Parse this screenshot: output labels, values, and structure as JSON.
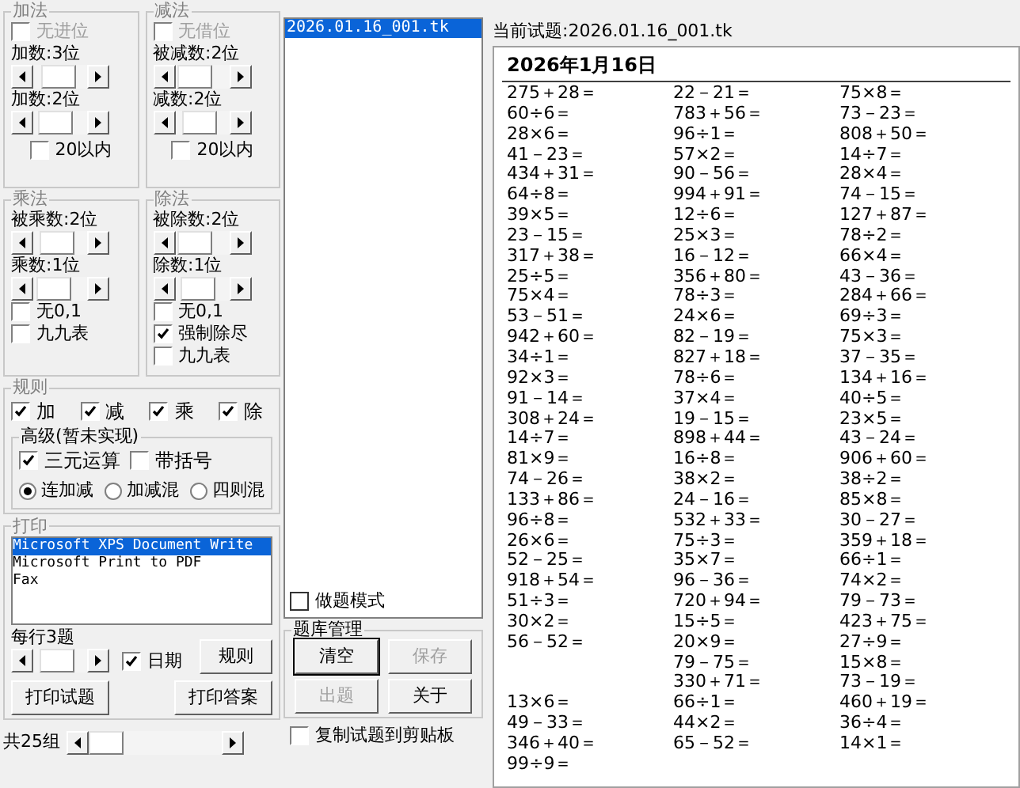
{
  "ops_groups": [
    {
      "title": "加法",
      "items": [
        {
          "kind": "checkbox",
          "label": "无进位",
          "checked": false,
          "disabled": true
        },
        {
          "kind": "slider",
          "label": "加数:3位",
          "level": 0.45
        },
        {
          "kind": "slider",
          "label": "加数:2位",
          "level": 0.25
        },
        {
          "kind": "footer_checkbox",
          "label": "20以内",
          "checked": false,
          "disabled": false
        }
      ]
    },
    {
      "title": "减法",
      "items": [
        {
          "kind": "checkbox",
          "label": "无借位",
          "checked": false,
          "disabled": true
        },
        {
          "kind": "slider",
          "label": "被减数:2位",
          "level": 0.15
        },
        {
          "kind": "slider",
          "label": "减数:2位",
          "level": 0.35
        },
        {
          "kind": "footer_checkbox",
          "label": "20以内",
          "checked": false,
          "disabled": false
        }
      ]
    },
    {
      "title": "乘法",
      "items": [
        {
          "kind": "slider",
          "label": "被乘数:2位",
          "level": 0.35
        },
        {
          "kind": "slider",
          "label": "乘数:1位",
          "level": 0.15
        },
        {
          "kind": "checkbox",
          "label": "无0,1",
          "checked": false,
          "disabled": false
        },
        {
          "kind": "checkbox",
          "label": "九九表",
          "checked": false,
          "disabled": false
        }
      ]
    },
    {
      "title": "除法",
      "items": [
        {
          "kind": "slider",
          "label": "被除数:2位",
          "level": 0.15
        },
        {
          "kind": "slider",
          "label": "除数:1位",
          "level": 0.3
        },
        {
          "kind": "checkbox",
          "label": "无0,1",
          "checked": false,
          "disabled": false
        },
        {
          "kind": "checkbox",
          "label": "强制除尽",
          "checked": true,
          "disabled": false
        },
        {
          "kind": "checkbox",
          "label": "九九表",
          "checked": false,
          "disabled": false
        }
      ]
    }
  ],
  "rules": {
    "title": "规则",
    "ops": [
      {
        "label": "加",
        "checked": true
      },
      {
        "label": "减",
        "checked": true
      },
      {
        "label": "乘",
        "checked": true
      },
      {
        "label": "除",
        "checked": true
      }
    ],
    "advanced": {
      "title": "高级(暂未实现)",
      "options": [
        {
          "label": "三元运算",
          "checked": true
        },
        {
          "label": "带括号",
          "checked": false
        }
      ],
      "modes": [
        {
          "label": "连加减",
          "selected": true
        },
        {
          "label": "加减混",
          "selected": false
        },
        {
          "label": "四则混",
          "selected": false
        }
      ]
    }
  },
  "print": {
    "title": "打印",
    "printers": [
      {
        "name": "Microsoft XPS Document Write",
        "selected": true
      },
      {
        "name": "Microsoft Print to PDF",
        "selected": false
      },
      {
        "name": "Fax",
        "selected": false
      }
    ],
    "per_row": {
      "label": "每行3题",
      "level": 0.3
    },
    "date": {
      "label": "日期",
      "checked": true
    },
    "rules_button": "规则",
    "print_questions": "打印试题",
    "print_answers": "打印答案"
  },
  "groups_count": {
    "label": "共25组",
    "level": 0
  },
  "files": [
    {
      "name": "2026.01.16_001.tk",
      "selected": true
    }
  ],
  "practice_mode": {
    "label": "做题模式",
    "checked": false
  },
  "bank": {
    "title": "题库管理",
    "buttons": [
      {
        "label": "清空",
        "disabled": false,
        "focused": true
      },
      {
        "label": "保存",
        "disabled": true,
        "focused": false
      },
      {
        "label": "出题",
        "disabled": true,
        "focused": false
      },
      {
        "label": "关于",
        "disabled": false,
        "focused": false
      }
    ]
  },
  "copy_to_clipboard": {
    "label": "复制试题到剪贴板",
    "checked": false
  },
  "current": "当前试题:2026.01.16_001.tk",
  "sheet": {
    "title": "2026年1月16日",
    "columns": [
      [
        "275＋28＝",
        "60÷6＝",
        "28×6＝",
        "41－23＝",
        "434＋31＝",
        "64÷8＝",
        "39×5＝",
        "23－15＝",
        "317＋38＝",
        "25÷5＝",
        "75×4＝",
        "53－51＝",
        "942＋60＝",
        "34÷1＝",
        "92×3＝",
        "91－14＝",
        "308＋24＝",
        "14÷7＝",
        "81×9＝",
        "74－26＝",
        "133＋86＝",
        "96÷8＝",
        "26×6＝",
        "52－25＝",
        "918＋54＝",
        "51÷3＝",
        "30×2＝",
        "56－52＝",
        null,
        null,
        "13×6＝",
        "49－33＝",
        "346＋40＝",
        "99÷9＝"
      ],
      [
        "22－21＝",
        "783＋56＝",
        "96÷1＝",
        "57×2＝",
        "90－56＝",
        "994＋91＝",
        "12÷6＝",
        "25×3＝",
        "16－12＝",
        "356＋80＝",
        "78÷3＝",
        "24×6＝",
        "82－19＝",
        "827＋18＝",
        "78÷6＝",
        "37×4＝",
        "19－15＝",
        "898＋44＝",
        "16÷8＝",
        "38×2＝",
        "24－16＝",
        "532＋33＝",
        "75÷3＝",
        "35×7＝",
        "96－36＝",
        "720＋94＝",
        "15÷5＝",
        "20×9＝",
        "79－75＝",
        "330＋71＝",
        "66÷1＝",
        "44×2＝",
        "65－52＝"
      ],
      [
        "75×8＝",
        "73－23＝",
        "808＋50＝",
        "14÷7＝",
        "28×4＝",
        "74－15＝",
        "127＋87＝",
        "78÷2＝",
        "66×4＝",
        "43－36＝",
        "284＋66＝",
        "69÷3＝",
        "75×3＝",
        "37－35＝",
        "134＋16＝",
        "40÷5＝",
        "23×5＝",
        "43－24＝",
        "906＋60＝",
        "38÷2＝",
        "85×8＝",
        "30－27＝",
        "359＋18＝",
        "66÷1＝",
        "74×2＝",
        "79－73＝",
        "423＋75＝",
        "27÷9＝",
        "15×8＝",
        "73－19＝",
        "460＋19＝",
        "36÷4＝",
        "14×1＝"
      ]
    ]
  }
}
